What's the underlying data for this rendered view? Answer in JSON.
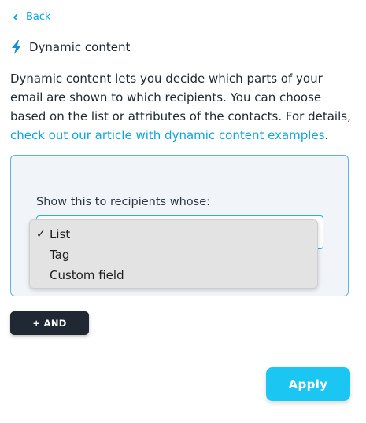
{
  "nav": {
    "back_label": "Back"
  },
  "header": {
    "title": "Dynamic content",
    "icon": "lightning-bolt-icon"
  },
  "description": {
    "text": "Dynamic content lets you decide which parts of your email are shown to which recipients. You can choose based on the list or attributes of the contacts. For details, ",
    "link_text": "check out our article with dynamic content examples",
    "suffix": "."
  },
  "condition": {
    "label": "Show this to recipients whose:",
    "selected": "List",
    "options": [
      {
        "label": "List",
        "checked": true
      },
      {
        "label": "Tag",
        "checked": false
      },
      {
        "label": "Custom field",
        "checked": false
      }
    ],
    "check_mark": "✓"
  },
  "actions": {
    "and_label": "+ AND",
    "apply_label": "Apply"
  },
  "colors": {
    "accent": "#0ea5d8",
    "apply_button": "#1cc6f2",
    "and_button": "#1f2833",
    "panel_background": "#f1f4f9",
    "panel_border": "#5ab8de"
  }
}
